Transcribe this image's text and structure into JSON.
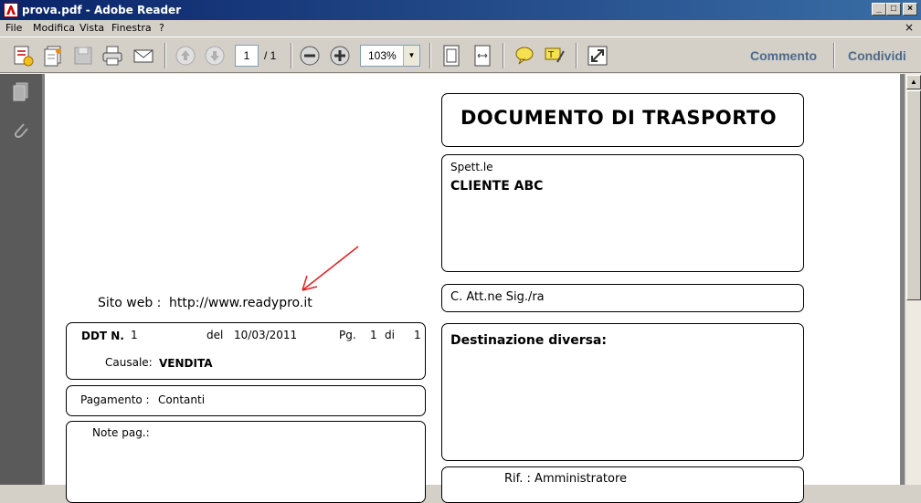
{
  "window": {
    "title": "prova.pdf - Adobe Reader",
    "minimize": "_",
    "maximize": "□",
    "close": "×"
  },
  "menu": {
    "items": [
      "File",
      "Modifica",
      "Vista",
      "Finestra",
      "?"
    ],
    "close_doc": "×"
  },
  "toolbar": {
    "page_current": "1",
    "page_total": "/ 1",
    "zoom": "103%",
    "comment_label": "Commento",
    "share_label": "Condividi"
  },
  "document": {
    "title": "DOCUMENTO DI TRASPORTO",
    "client_label": "Spett.le",
    "client_name": "CLIENTE ABC",
    "attention_label": "C. Att.ne Sig./ra",
    "destination_label": "Destinazione diversa:",
    "reference_label": "Rif. : Amministratore",
    "website_label": "Sito web :",
    "website_url": "http://www.readypro.it",
    "ddt_label": "DDT N.",
    "ddt_number": "1",
    "date_label": "del",
    "date_value": "10/03/2011",
    "page_label": "Pg.",
    "page_num": "1",
    "page_of": "di",
    "page_total": "1",
    "causale_label": "Causale:",
    "causale_value": "VENDITA",
    "payment_label": "Pagamento :",
    "payment_value": "Contanti",
    "notes_label": "Note pag.:"
  },
  "colors": {
    "titlebar": "#0a246a",
    "arrow": "#e02020",
    "share_text": "#4b6a8f"
  }
}
